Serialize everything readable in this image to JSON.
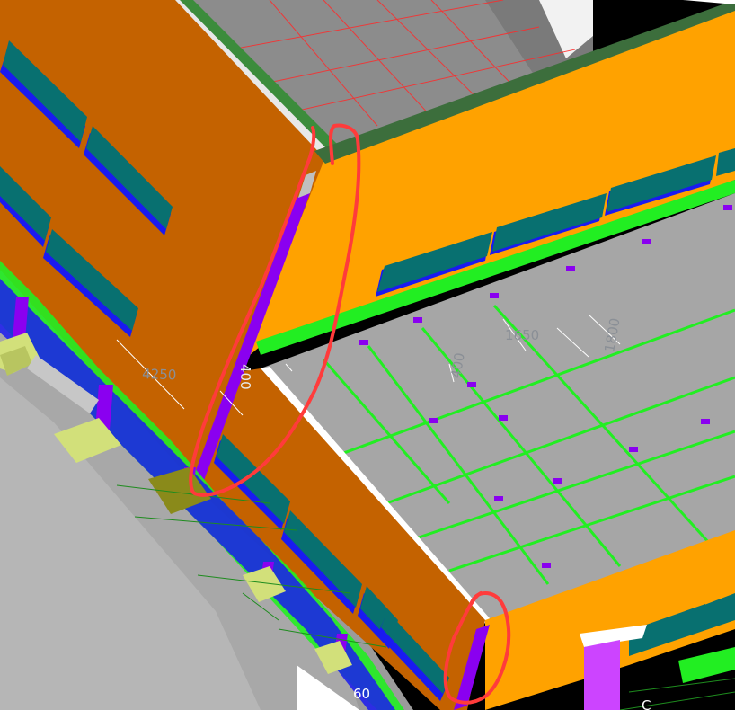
{
  "viewport": {
    "dimensions": [
      {
        "label": "4250"
      },
      {
        "label": "1650"
      },
      {
        "label": "1800"
      },
      {
        "label": "400"
      },
      {
        "label": "400"
      }
    ],
    "axis_labels": [
      "60",
      "C"
    ]
  },
  "colors": {
    "background": "#000000",
    "wall_dark_orange": "#C46200",
    "wall_orange": "#FFA200",
    "roof_gray": "#A6A6A6",
    "glazing_teal": "#087070",
    "frame_blue": "#1A1AF0",
    "column_purple": "#8A00F0",
    "beam_green": "#22EE22",
    "footing_yellow": "#D2E07A",
    "markup_red": "#FF3B3B"
  }
}
